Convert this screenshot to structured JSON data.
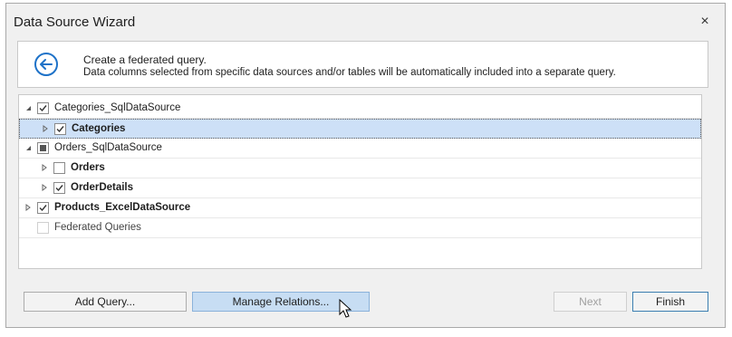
{
  "window": {
    "title": "Data Source Wizard",
    "close_glyph": "×"
  },
  "header": {
    "line1": "Create a federated query.",
    "line2": "Data columns selected from specific data sources and/or tables will be automatically included into a separate query."
  },
  "tree": {
    "rows": [
      {
        "label": "Categories_SqlDataSource",
        "bold": false,
        "expanded": true,
        "check": "checked",
        "level": 0,
        "selected": false
      },
      {
        "label": "Categories",
        "bold": true,
        "expanded": false,
        "check": "checked",
        "level": 1,
        "selected": true
      },
      {
        "label": "Orders_SqlDataSource",
        "bold": false,
        "expanded": true,
        "check": "indeterminate",
        "level": 0,
        "selected": false
      },
      {
        "label": "Orders",
        "bold": true,
        "expanded": false,
        "check": "unchecked",
        "level": 1,
        "selected": false
      },
      {
        "label": "OrderDetails",
        "bold": true,
        "expanded": false,
        "check": "checked",
        "level": 1,
        "selected": false
      },
      {
        "label": "Products_ExcelDataSource",
        "bold": true,
        "expanded": false,
        "check": "checked",
        "level": 0,
        "selected": false
      },
      {
        "label": "Federated Queries",
        "bold": false,
        "expanded": null,
        "check": "disabled",
        "level": 0,
        "selected": false
      }
    ]
  },
  "buttons": {
    "add_query": "Add Query...",
    "manage_relations": "Manage Relations...",
    "next": "Next",
    "finish": "Finish"
  },
  "colors": {
    "accent": "#1e72c8",
    "selection": "#cde0f7",
    "hover_button": "#c7ddf3"
  }
}
